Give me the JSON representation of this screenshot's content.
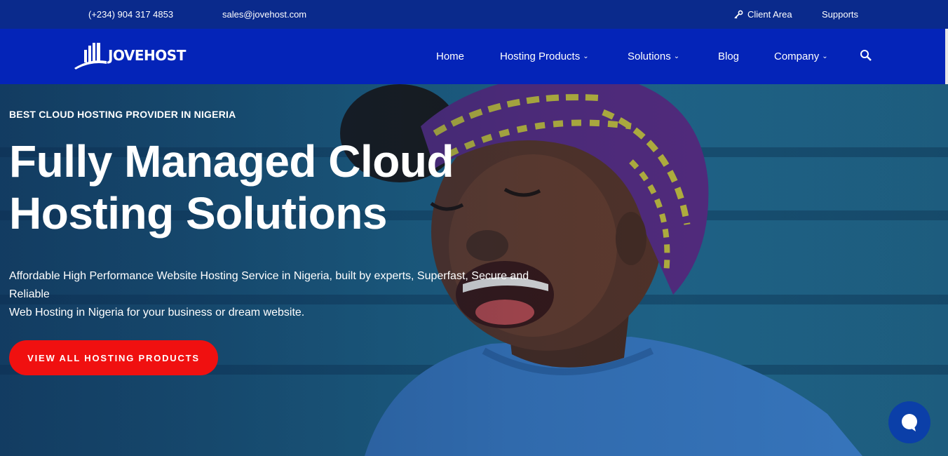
{
  "topbar": {
    "phone": "(+234) 904 317 4853",
    "email": "sales@jovehost.com",
    "client_area": "Client Area",
    "supports": "Supports"
  },
  "brand": {
    "name": "JOVEHOST"
  },
  "nav": {
    "home": "Home",
    "hosting_products": "Hosting Products",
    "solutions": "Solutions",
    "blog": "Blog",
    "company": "Company"
  },
  "hero": {
    "tagline": "BEST CLOUD HOSTING PROVIDER IN NIGERIA",
    "headline_line1": "Fully Managed Cloud",
    "headline_line2": "Hosting Solutions",
    "description_line1": "Affordable High Performance Website Hosting Service in Nigeria, built by experts, Superfast, Secure and Reliable",
    "description_line2": "Web Hosting in Nigeria for your business or dream website.",
    "cta": "VIEW ALL HOSTING PRODUCTS"
  },
  "icons": {
    "client_area": "key-icon",
    "search": "search-icon",
    "chat": "chat-bubble-icon",
    "dropdown": "chevron-down-icon"
  },
  "colors": {
    "topbar_bg": "#0a2a8c",
    "navbar_bg": "#0424b8",
    "cta_bg": "#f01010",
    "chat_bg": "#0b3fa8"
  }
}
